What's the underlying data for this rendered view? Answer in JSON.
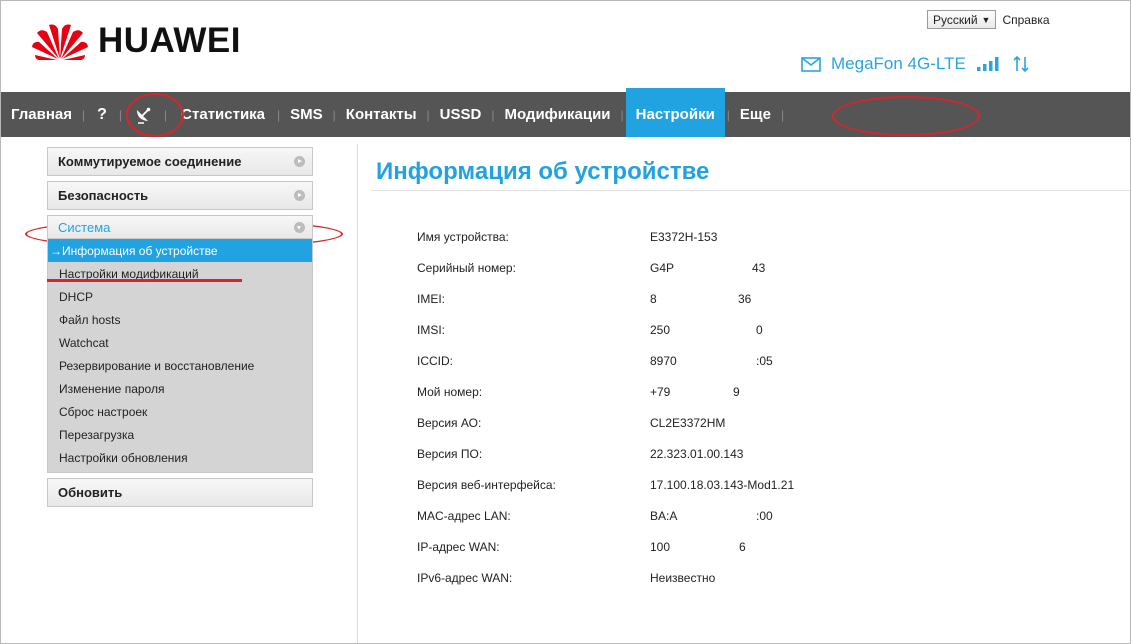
{
  "header": {
    "logo_text": "HUAWEI",
    "language": "Русский",
    "help": "Справка",
    "operator": "MegaFon 4G-LTE",
    "brand_color": "#e60012",
    "accent_color": "#21a3e1"
  },
  "nav": {
    "items": [
      "Главная",
      "?",
      "Статистика",
      "SMS",
      "Контакты",
      "USSD",
      "Модификации",
      "Настройки",
      "Еще"
    ],
    "active": "Настройки"
  },
  "sidebar": {
    "groups": [
      "Коммутируемое соединение",
      "Безопасность",
      "Система"
    ],
    "system_items": [
      "→Информация об устройстве",
      "Настройки модификаций",
      "DHCP",
      "Файл hosts",
      "Watchcat",
      "Резервирование и восстановление",
      "Изменение пароля",
      "Сброс настроек",
      "Перезагрузка",
      "Настройки обновления"
    ],
    "refresh": "Обновить"
  },
  "content": {
    "title": "Информация об устройстве",
    "rows": [
      {
        "label": "Имя устройства:",
        "value": "E3372H-153",
        "value2": ""
      },
      {
        "label": "Серийный номер:",
        "value": "G4P",
        "value2": "43"
      },
      {
        "label": "IMEI:",
        "value": "8",
        "value2": "36"
      },
      {
        "label": "IMSI:",
        "value": "250",
        "value2": "0"
      },
      {
        "label": "ICCID:",
        "value": "8970",
        "value2": ":05"
      },
      {
        "label": "Мой номер:",
        "value": "+79",
        "value2": "9"
      },
      {
        "label": "Версия АО:",
        "value": "CL2E3372HM",
        "value2": ""
      },
      {
        "label": "Версия ПО:",
        "value": "22.323.01.00.143",
        "value2": ""
      },
      {
        "label": "Версия веб-интерфейса:",
        "value": "17.100.18.03.143-Mod1.21",
        "value2": ""
      },
      {
        "label": "MAC-адрес LAN:",
        "value": "BA:A",
        "value2": ":00"
      },
      {
        "label": "IP-адрес WAN:",
        "value": "100",
        "value2": "6"
      },
      {
        "label": "IPv6-адрес WAN:",
        "value": "Неизвестно",
        "value2": ""
      }
    ]
  }
}
